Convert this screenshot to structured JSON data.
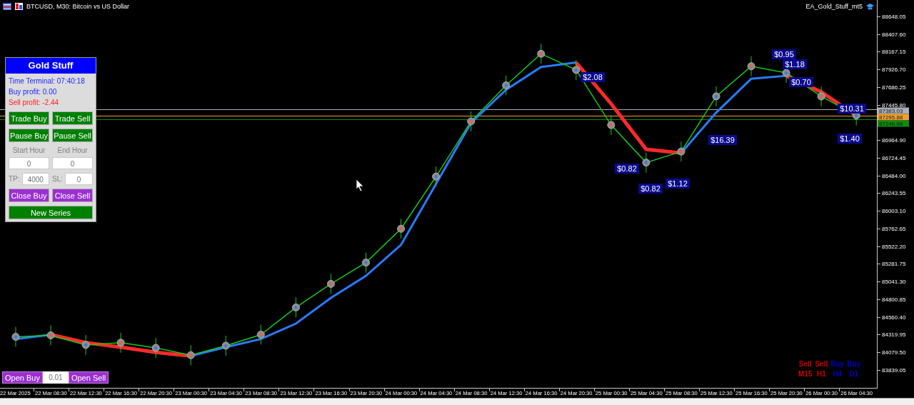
{
  "window": {
    "title": "BTCUSD, M30:  Bitcoin vs US Dollar",
    "expert": "EA_Gold_Stuff_mt5"
  },
  "chart": {
    "chart_data": {
      "type": "line",
      "x": [
        "22 Mar 2025",
        "22 Mar 08:30",
        "22 Mar 12:30",
        "22 Mar 16:30",
        "22 Mar 20:30",
        "23 Mar 00:30",
        "23 Mar 04:30",
        "23 Mar 08:30",
        "23 Mar 12:30",
        "23 Mar 16:30",
        "23 Mar 20:30",
        "24 Mar 00:30",
        "24 Mar 04:30",
        "24 Mar 08:30",
        "24 Mar 12:30",
        "24 Mar 16:30",
        "24 Mar 20:30",
        "25 Mar 00:30",
        "25 Mar 04:30",
        "25 Mar 08:30",
        "25 Mar 12:30",
        "25 Mar 16:30",
        "25 Mar 20:30",
        "26 Mar 00:30",
        "26 Mar 04:30"
      ],
      "series": [
        {
          "color": "#19c819",
          "marker": "circle",
          "values": [
            84290,
            84310,
            84180,
            84210,
            84140,
            84040,
            84170,
            84320,
            84690,
            85010,
            85300,
            85760,
            86470,
            87220,
            87710,
            88140,
            87920,
            87170,
            86660,
            86810,
            87560,
            87970,
            87880,
            87560,
            87300
          ]
        },
        {
          "color": "#2a7bff",
          "values": [
            84260,
            84320,
            null,
            null,
            null,
            84030,
            84150,
            84260,
            84470,
            84820,
            85120,
            85540,
            86370,
            87200,
            87650,
            87960,
            88020,
            null,
            null,
            86790,
            87340,
            87800,
            87840,
            null,
            null
          ]
        },
        {
          "color": "#ff2a2a",
          "values": [
            null,
            84320,
            84210,
            84150,
            84080,
            84030,
            null,
            null,
            null,
            null,
            null,
            null,
            null,
            null,
            null,
            null,
            88020,
            87460,
            86840,
            86790,
            null,
            null,
            87840,
            87620,
            87300
          ]
        }
      ],
      "ylim": [
        83596,
        88871
      ],
      "yticks": [
        {
          "value": 88648.05,
          "label": "88648.05"
        },
        {
          "value": 88407.6,
          "label": "88407.60"
        },
        {
          "value": 88167.15,
          "label": "88167.15"
        },
        {
          "value": 87926.7,
          "label": "87926.70"
        },
        {
          "value": 87686.25,
          "label": "87686.25"
        },
        {
          "value": 87445.8,
          "label": "87445.80"
        },
        {
          "value": 86964.9,
          "label": "86964.90"
        },
        {
          "value": 86724.45,
          "label": "86724.45"
        },
        {
          "value": 86484,
          "label": "86484.00"
        },
        {
          "value": 86243.55,
          "label": "86243.55"
        },
        {
          "value": 86003.1,
          "label": "86003.10"
        },
        {
          "value": 85762.65,
          "label": "85762.65"
        },
        {
          "value": 85522.2,
          "label": "85522.20"
        },
        {
          "value": 85281.75,
          "label": "85281.75"
        },
        {
          "value": 85041.3,
          "label": "85041.30"
        },
        {
          "value": 84800.85,
          "label": "84800.85"
        },
        {
          "value": 84560.4,
          "label": "84560.40"
        },
        {
          "value": 84319.95,
          "label": "84319.95"
        },
        {
          "value": 84079.5,
          "label": "84079.50"
        },
        {
          "value": 83839.05,
          "label": "83839.05"
        }
      ],
      "ref_lines": [
        {
          "axis": "y",
          "value": 87383.03,
          "label": "87383.03",
          "color": "#a7b0b8"
        },
        {
          "axis": "y",
          "value": 87295.88,
          "label": "87295.88",
          "color": "#f0a030"
        },
        {
          "axis": "y",
          "value": 87246.88,
          "label": "87246.88",
          "color": "#108c10"
        }
      ],
      "annotations": [
        "$2.08",
        "$0.95",
        "$1.18",
        "$0.70",
        "$10.31",
        "$16.39",
        "$1.40",
        "$1.12",
        "$0.82",
        "$0.82"
      ]
    }
  },
  "panel": {
    "title": "Gold Stuff",
    "time": "Time Terminal: 07:40:18",
    "buy_profit": "Buy profit: 0.00",
    "sell_profit": "Sell profit: -2.44",
    "trade_buttons": [
      "Trade Buy",
      "Trade Sell"
    ],
    "pause_buttons": [
      "Pause Buy",
      "Pause Sell"
    ],
    "hour_labels": [
      "Start Hour",
      "End Hour"
    ],
    "hours": [
      "0",
      "0"
    ],
    "tp": {
      "label": "TP:",
      "value": "4000"
    },
    "sl": {
      "label": "SL:",
      "value": "0"
    },
    "close_buttons": [
      "Close Buy",
      "Close Sell"
    ],
    "new_series": "New Series"
  },
  "order_bar": {
    "buttons": [
      "Open Buy",
      "Open Sell"
    ],
    "lot": "0.01"
  },
  "signals": [
    {
      "direction": "Sell",
      "timeframe": "M15",
      "color": "#d00000"
    },
    {
      "direction": "Sell",
      "timeframe": "H1",
      "color": "#d00000"
    },
    {
      "direction": "Buy",
      "timeframe": "H4",
      "color": "#0000c8"
    },
    {
      "direction": "Buy",
      "timeframe": "D1",
      "color": "#0000c8"
    }
  ]
}
